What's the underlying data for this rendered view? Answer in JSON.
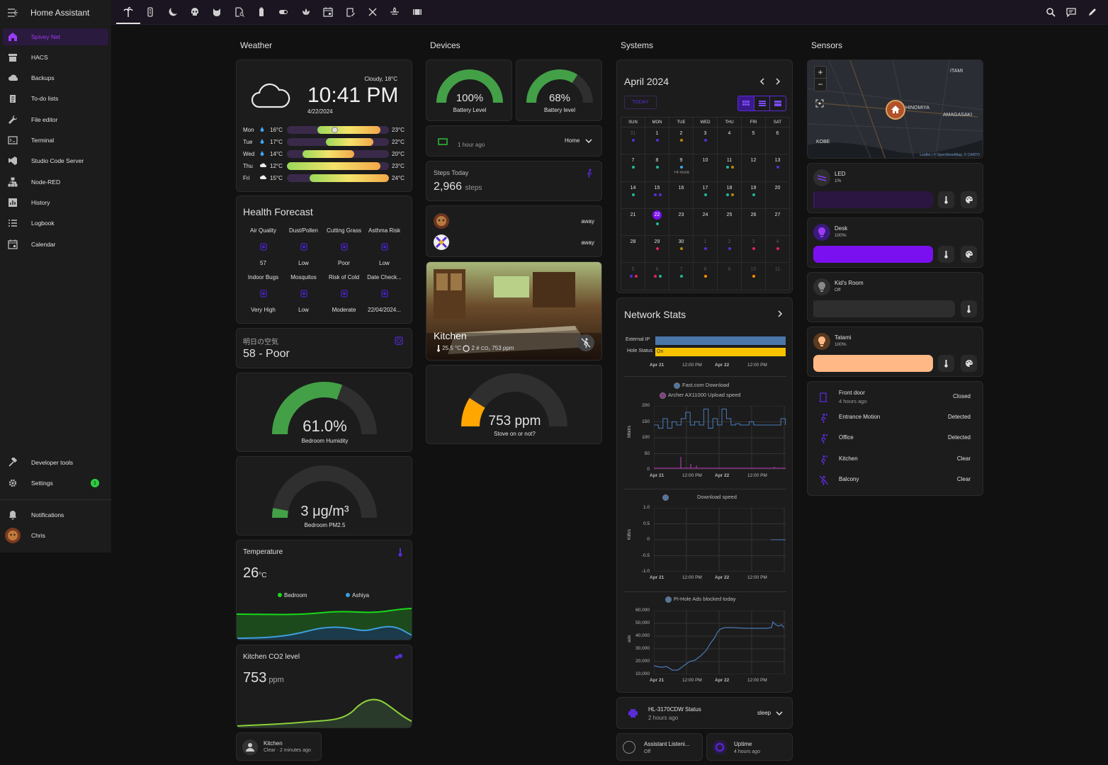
{
  "app": {
    "title": "Home Assistant"
  },
  "sidebar": {
    "items": [
      {
        "label": "Spivey Net",
        "icon": "home-dashboard-icon",
        "active": true
      },
      {
        "label": "HACS",
        "icon": "store-icon"
      },
      {
        "label": "Backups",
        "icon": "cloud-icon"
      },
      {
        "label": "To-do lists",
        "icon": "clipboard-list-icon"
      },
      {
        "label": "File editor",
        "icon": "wrench-icon"
      },
      {
        "label": "Terminal",
        "icon": "console-icon"
      },
      {
        "label": "Studio Code Server",
        "icon": "vscode-icon"
      },
      {
        "label": "Node-RED",
        "icon": "sitemap-icon"
      },
      {
        "label": "History",
        "icon": "chart-box-icon"
      },
      {
        "label": "Logbook",
        "icon": "format-list-icon"
      },
      {
        "label": "Calendar",
        "icon": "calendar-icon"
      }
    ],
    "bottom": [
      {
        "label": "Developer tools",
        "icon": "hammer-icon"
      },
      {
        "label": "Settings",
        "icon": "cog-icon",
        "badge": "1"
      }
    ],
    "footer": [
      {
        "label": "Notifications",
        "icon": "bell-icon"
      },
      {
        "label": "Chris",
        "icon": "avatar-icon"
      }
    ]
  },
  "topbar": {
    "tabs": [
      "palm-tree-icon",
      "remote-icon",
      "moon-icon",
      "skull-icon",
      "cat-icon",
      "file-search-icon",
      "battery-icon",
      "toggle-icon",
      "lotus-icon",
      "calendar-icon",
      "clipboard-edit-icon",
      "tools-icon",
      "spa-icon",
      "film-icon"
    ],
    "actions": [
      "search-icon",
      "chat-icon",
      "pencil-icon"
    ]
  },
  "columns": {
    "weather": "Weather",
    "devices": "Devices",
    "systems": "Systems",
    "sensors": "Sensors"
  },
  "weather": {
    "condition": "Cloudy, 18°C",
    "time": "10:41 PM",
    "date": "4/22/2024",
    "forecast": [
      {
        "day": "Mon",
        "low": "16°C",
        "high": "23°C",
        "from": 0.3,
        "to": 0.92
      },
      {
        "day": "Tue",
        "low": "17°C",
        "high": "22°C",
        "from": 0.38,
        "to": 0.85
      },
      {
        "day": "Wed",
        "low": "14°C",
        "high": "20°C",
        "from": 0.15,
        "to": 0.66
      },
      {
        "day": "Thu",
        "low": "12°C",
        "high": "23°C",
        "from": 0.0,
        "to": 0.92
      },
      {
        "day": "Fri",
        "low": "15°C",
        "high": "24°C",
        "from": 0.22,
        "to": 1.0
      }
    ]
  },
  "health": {
    "title": "Health Forecast",
    "items": [
      {
        "label": "Air Quality",
        "value": "57"
      },
      {
        "label": "Dust/Pollen",
        "value": "Low"
      },
      {
        "label": "Cutting Grass",
        "value": "Poor"
      },
      {
        "label": "Asthma Risk",
        "value": "Low"
      },
      {
        "label": "Indoor Bugs",
        "value": "Very High"
      },
      {
        "label": "Mosquitos",
        "value": "Low"
      },
      {
        "label": "Risk of Cold",
        "value": "Moderate"
      },
      {
        "label": "Date Check...",
        "value": "22/04/2024..."
      }
    ]
  },
  "air_tomorrow": {
    "label": "明日の空気",
    "value": "58 - Poor"
  },
  "humidity": {
    "value": "61.0%",
    "label": "Bedroom Humidity",
    "fraction": 0.61
  },
  "pm25": {
    "value": "3 μg/m³",
    "label": "Bedroom PM2.5",
    "fraction": 0.06
  },
  "temperature": {
    "title": "Temperature",
    "value": "26",
    "unit": "°C",
    "legend": [
      "Bedroom",
      "Ashiya"
    ]
  },
  "co2": {
    "title": "Kitchen CO2 level",
    "value": "753",
    "unit": "ppm"
  },
  "kitchen_presence": {
    "name": "Kitchen",
    "state": "Clear · 2 minutes ago"
  },
  "devices": {
    "battery1": {
      "value": "100%",
      "label": "Battery Level",
      "fraction": 1.0
    },
    "battery2": {
      "value": "68%",
      "label": "Battery level",
      "fraction": 0.68
    },
    "tracker": {
      "time": "1 hour ago",
      "state": "Home"
    },
    "steps": {
      "label": "Steps Today",
      "value": "2,966",
      "unit": "steps"
    },
    "persons": [
      {
        "state": "away"
      },
      {
        "state": "away"
      }
    ],
    "kitchen": {
      "name": "Kitchen",
      "temp": "25.5 °C",
      "count": "2 #",
      "co2": "753 ppm"
    },
    "stove": {
      "value": "753 ppm",
      "label": "Stove on or not?",
      "fraction": 0.18
    }
  },
  "calendar": {
    "month": "April 2024",
    "today_label": "TODAY",
    "weekdays": [
      "SUN",
      "MON",
      "TUE",
      "WED",
      "THU",
      "FRI",
      "SAT"
    ],
    "weeks": [
      [
        "31",
        "1",
        "2",
        "3",
        "4",
        "5",
        "6"
      ],
      [
        "7",
        "8",
        "9",
        "10",
        "11",
        "12",
        "13"
      ],
      [
        "14",
        "15",
        "16",
        "17",
        "18",
        "19",
        "20"
      ],
      [
        "21",
        "22",
        "23",
        "24",
        "25",
        "26",
        "27"
      ],
      [
        "28",
        "29",
        "30",
        "1",
        "2",
        "3",
        "4"
      ],
      [
        "5",
        "6",
        "7",
        "8",
        "9",
        "10",
        "11"
      ]
    ],
    "more": "+4 more"
  },
  "network": {
    "title": "Network Stats",
    "timeline_labels": [
      "External IP",
      "Hole Status"
    ],
    "timeline_on": "On",
    "x_ticks": [
      "Apr 21",
      "12:00 PM",
      "Apr 22",
      "12:00 PM"
    ],
    "chart1": {
      "legend": [
        "Fast.com Download",
        "Archer AX11000 Upload speed"
      ],
      "ylabel": "Mbit/s",
      "yticks": [
        "200",
        "150",
        "100",
        "50",
        "0"
      ]
    },
    "chart2": {
      "legend": [
        "Download speed"
      ],
      "ylabel": "KiB/s",
      "yticks": [
        "1.0",
        "0.5",
        "0",
        "-0.5",
        "-1.0"
      ]
    },
    "chart3": {
      "legend": [
        "Pi-Hole Ads blocked today"
      ],
      "ylabel": "ads",
      "yticks": [
        "60,000",
        "50,000",
        "40,000",
        "30,000",
        "20,000",
        "10,000"
      ]
    }
  },
  "printer": {
    "name": "HL-3170CDW Status",
    "time": "2 hours ago",
    "state": "sleep"
  },
  "assistant": {
    "name": "Assistant Listeni...",
    "state": "Off"
  },
  "uptime": {
    "name": "Uptime",
    "state": "4 hours ago"
  },
  "map": {
    "labels": [
      "ITAMI",
      "HINOMIYA",
      "AMAGASAKI",
      "KOBE"
    ],
    "attribution": "Leaflet | © OpenStreetMap, © CARTO"
  },
  "lights": [
    {
      "name": "LED",
      "state": "1%",
      "color": "#3a1a5a",
      "fill": 0.01
    },
    {
      "name": "Desk",
      "state": "100%",
      "color": "#7a10f0",
      "fill": 1.0
    },
    {
      "name": "Kid's Room",
      "state": "Off",
      "color": "#2e2e2e",
      "fill": 0
    },
    {
      "name": "Tatami",
      "state": "100%",
      "color": "#ffb886",
      "fill": 1.0
    }
  ],
  "sensors": [
    {
      "name": "Front door",
      "sub": "4 hours ago",
      "state": "Closed"
    },
    {
      "name": "Entrance Motion",
      "state": "Detected"
    },
    {
      "name": "Office",
      "state": "Detected"
    },
    {
      "name": "Kitchen",
      "state": "Clear"
    },
    {
      "name": "Balcony",
      "state": "Clear"
    }
  ]
}
